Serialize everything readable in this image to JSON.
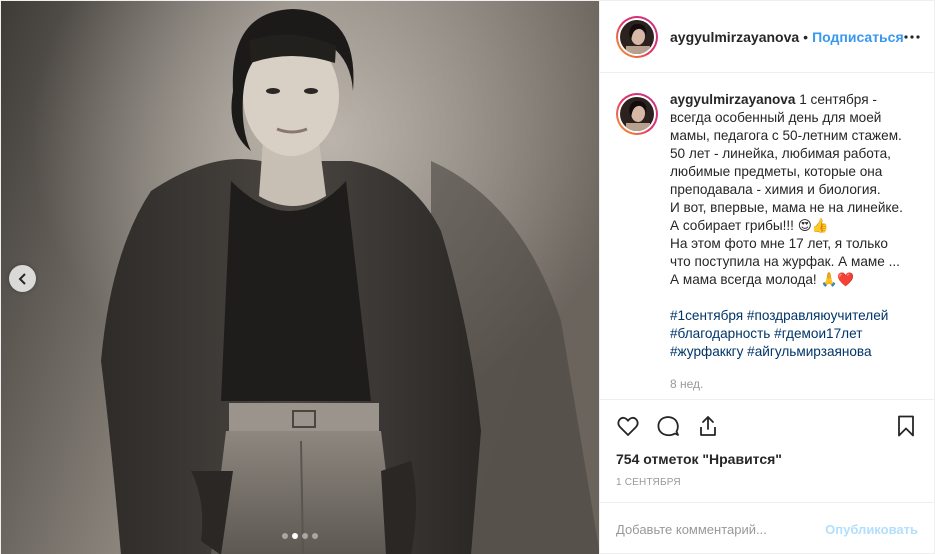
{
  "post": {
    "username": "aygyulmirzayanova",
    "separator": "•",
    "follow_label": "Подписаться",
    "caption_first": "1 сентября -",
    "caption_lines": [
      "всегда особенный день для моей",
      "мамы, педагога с 50-летним стажем.",
      "50 лет - линейка, любимая работа,",
      "любимые предметы, которые она",
      "преподавала - химия и биология.",
      "И вот, впервые, мама не на линейке.",
      "А собирает грибы!!! 😍👍",
      "На этом фото мне 17 лет, я только",
      "что поступила на журфак. А маме ...",
      "А мама всегда молода! 🙏❤️"
    ],
    "hashtags": [
      "#1сентября #поздравляюучителей",
      "#благодарность #гдемои17лет",
      "#журфаккгу #айгульмирзаянова"
    ],
    "relative_time": "8 нед.",
    "likes_text": "754 отметок \"Нравится\"",
    "date_text": "1 сентября",
    "comment_placeholder": "Добавьте комментарий...",
    "publish_label": "Опубликовать"
  },
  "carousel": {
    "slide_count": 4,
    "active_index": 2
  },
  "icons": {
    "more": "more-dots-icon",
    "like": "heart-icon",
    "comment": "comment-bubble-icon",
    "share": "share-icon",
    "save": "bookmark-icon",
    "prev": "chevron-left-icon"
  },
  "colors": {
    "link_blue": "#3897f0",
    "hashtag_blue": "#003569",
    "muted_gray": "#999999",
    "publish_disabled": "#b2dffc"
  }
}
